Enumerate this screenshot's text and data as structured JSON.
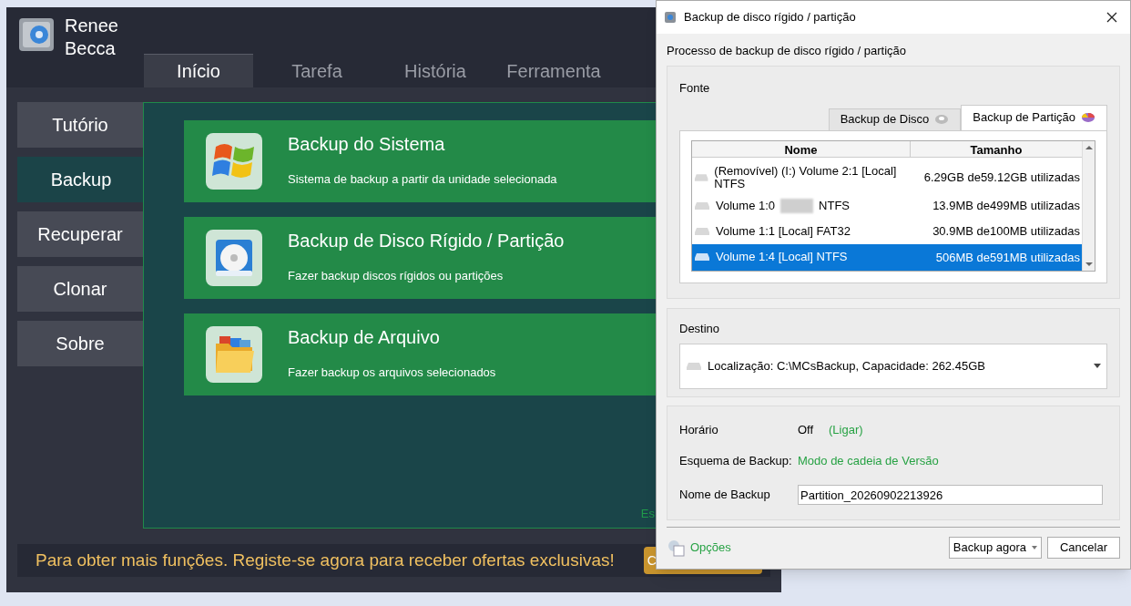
{
  "app": {
    "logo_lines": [
      "Renee",
      "Becca"
    ],
    "tabs": [
      {
        "label": "Início",
        "selected": true
      },
      {
        "label": "Tarefa",
        "selected": false
      },
      {
        "label": "História",
        "selected": false
      },
      {
        "label": "Ferramenta",
        "selected": false
      }
    ],
    "sidebar": [
      {
        "label": "Tutório",
        "selected": false
      },
      {
        "label": "Backup",
        "selected": true
      },
      {
        "label": "Recuperar",
        "selected": false
      },
      {
        "label": "Clonar",
        "selected": false
      },
      {
        "label": "Sobre",
        "selected": false
      }
    ],
    "cards": [
      {
        "kind": "system",
        "title": "Backup do Sistema",
        "description": "Sistema de backup a partir da unidade selecionada"
      },
      {
        "kind": "disk",
        "title": "Backup de Disco Rígido / Partição",
        "description": "Fazer backup discos rígidos ou partições"
      },
      {
        "kind": "file",
        "title": "Backup de Arquivo",
        "description": "Fazer backup os arquivos selecionados"
      }
    ],
    "corner_text": "Es",
    "promo": "Para obter mais funções. Registe-se agora para receber ofertas exclusivas!",
    "promo_button": "C"
  },
  "dialog": {
    "title": "Backup de disco rígido / partição",
    "heading": "Processo de backup de disco rígido / partição",
    "source_label": "Fonte",
    "source_tabs": [
      {
        "label": "Backup de Disco",
        "kind": "disk",
        "selected": false
      },
      {
        "label": "Backup de Partição",
        "kind": "partition",
        "selected": true
      }
    ],
    "columns": [
      "Nome",
      "Tamanho"
    ],
    "rows": [
      {
        "name": "(Removível) (I:) Volume 2:1 [Local] NTFS",
        "size": "6.29GB de59.12GB utilizadas",
        "selected": false
      },
      {
        "name": "Volume 1:0",
        "name_after_blur": "NTFS",
        "size": "13.9MB de499MB utilizadas",
        "selected": false
      },
      {
        "name": "Volume 1:1 [Local] FAT32",
        "size": "30.9MB de100MB utilizadas",
        "selected": false
      },
      {
        "name": "Volume 1:4 [Local] NTFS",
        "size": "506MB de591MB utilizadas",
        "selected": true
      }
    ],
    "destination_label": "Destino",
    "destination": "Localização: C:\\MCsBackup, Capacidade: 262.45GB",
    "schedule_label": "Horário",
    "schedule_value": "Off",
    "schedule_link": "(Ligar)",
    "scheme_label": "Esquema de Backup:",
    "scheme_value": "Modo de cadeia de Versão",
    "name_label": "Nome de Backup",
    "name_value": "Partition_20260902213926",
    "options": "Opções",
    "buttons": [
      "Backup agora",
      "Cancelar"
    ]
  }
}
